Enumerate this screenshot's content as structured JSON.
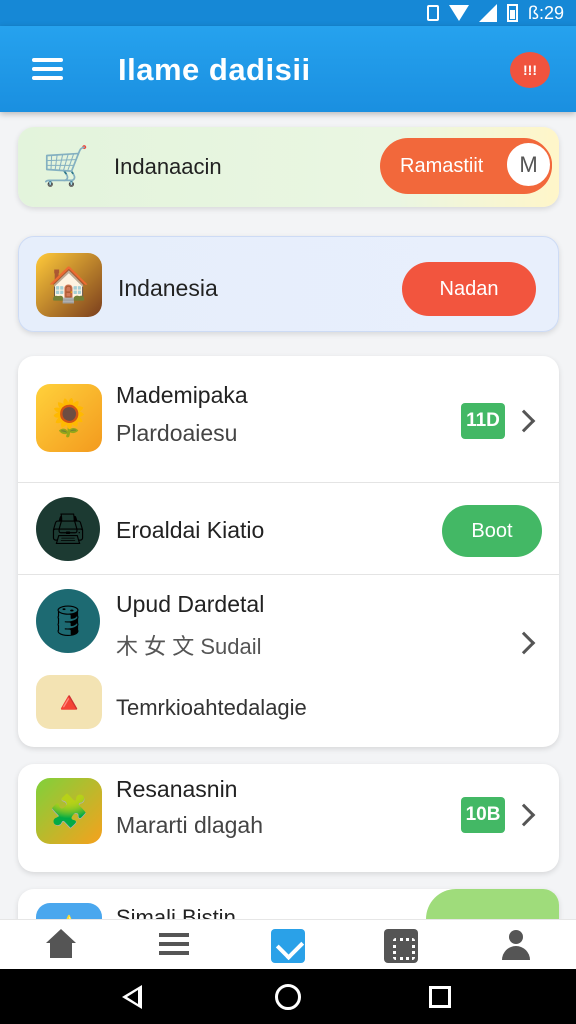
{
  "status_bar": {
    "time": "ß:29",
    "icons": [
      "vibrate-icon",
      "wifi-icon",
      "signal-icon",
      "battery-icon"
    ]
  },
  "app_bar": {
    "title": "Ilame dadisii",
    "menu_icon": "menu-icon",
    "chat_icon_label": "!!!"
  },
  "cards": {
    "card1": {
      "label": "Indanaacin",
      "button": "Ramastiit",
      "icon": "cart-icon"
    },
    "card2": {
      "label": "Indanesia",
      "button": "Nadan",
      "icon": "game-icon"
    },
    "list": [
      {
        "title": "Mademipaka",
        "subtitle": "Plardoaiesu",
        "badge": "11D"
      },
      {
        "title": "Eroaldai Kiatio",
        "button": "Boot"
      },
      {
        "title": "Upud Dardetal",
        "subtitle": "木 女 文 Sudail"
      },
      {
        "title": "Temrkioahtedalagie"
      }
    ],
    "card4": {
      "title": "Resanasnin",
      "subtitle": "Mararti dlagah",
      "badge": "10B"
    },
    "card5": {
      "title": "Simali Bistin"
    }
  },
  "colors": {
    "primary": "#1a8fe0",
    "accent_orange": "#f2683b",
    "accent_red": "#f2553e",
    "green": "#43b865"
  }
}
